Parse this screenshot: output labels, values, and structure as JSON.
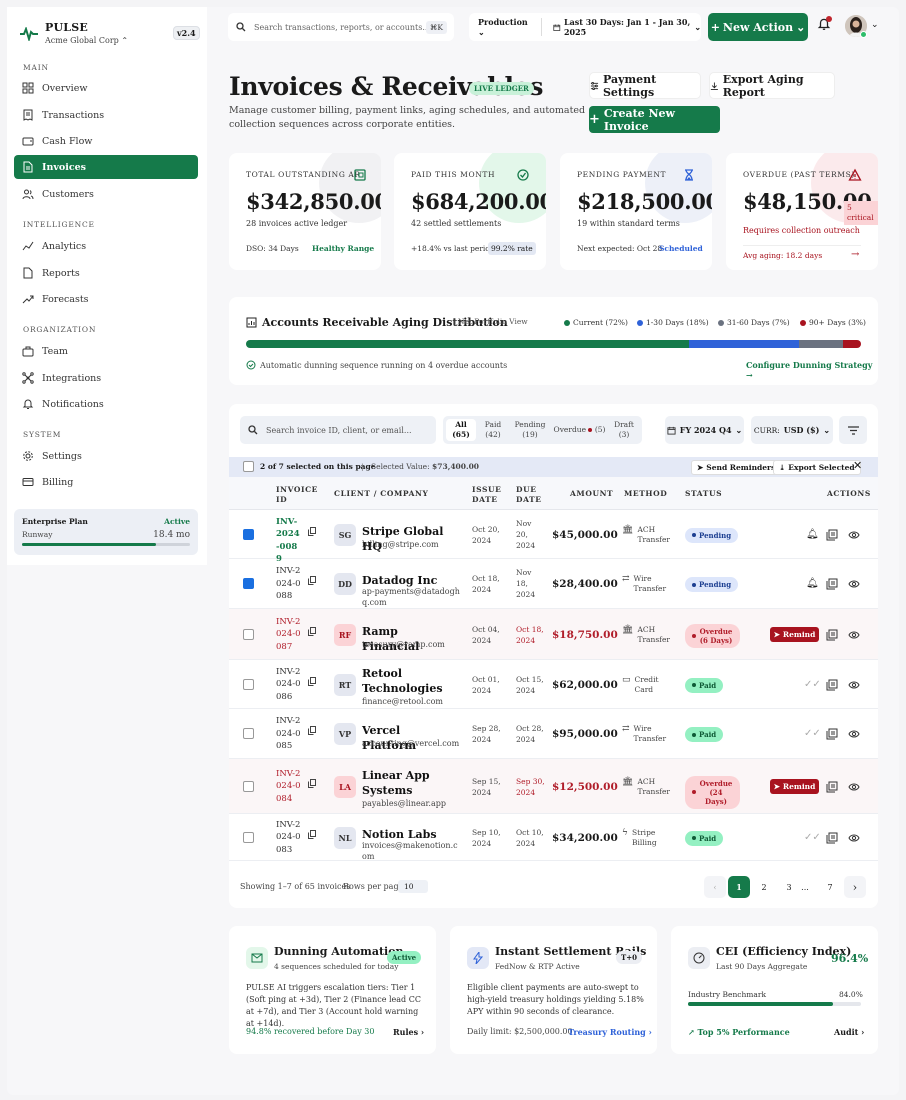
{
  "brand": {
    "name": "PULSE",
    "org": "Acme Global Corp",
    "version": "v2.4"
  },
  "nav": {
    "sections": {
      "main": "MAIN",
      "intelligence": "INTELLIGENCE",
      "organization": "ORGANIZATION",
      "system": "SYSTEM"
    },
    "items": [
      {
        "label": "Overview",
        "icon": "grid-icon"
      },
      {
        "label": "Transactions",
        "icon": "receipt-icon"
      },
      {
        "label": "Cash Flow",
        "icon": "wallet-icon"
      },
      {
        "label": "Invoices",
        "icon": "document-icon",
        "active": true
      },
      {
        "label": "Customers",
        "icon": "users-icon"
      },
      {
        "label": "Analytics",
        "icon": "trend-icon"
      },
      {
        "label": "Reports",
        "icon": "file-icon"
      },
      {
        "label": "Forecasts",
        "icon": "chart-up-icon"
      },
      {
        "label": "Team",
        "icon": "briefcase-icon"
      },
      {
        "label": "Integrations",
        "icon": "network-icon"
      },
      {
        "label": "Notifications",
        "icon": "bell-icon"
      },
      {
        "label": "Settings",
        "icon": "gear-icon"
      },
      {
        "label": "Billing",
        "icon": "credit-card-icon"
      }
    ]
  },
  "plan": {
    "title": "Enterprise Plan",
    "status": "Active",
    "runway_label": "Runway",
    "runway_value": "18.4 mo",
    "runway_progress": 0.8
  },
  "topbar": {
    "search_placeholder": "Search transactions, reports, or accounts...",
    "shortcut": "⌘K",
    "environment": "Production",
    "date_range": "Last 30 Days: Jan 1 - Jan 30, 2025",
    "new_action": "New Action"
  },
  "header": {
    "title": "Invoices & Receivables",
    "badge": "LIVE LEDGER",
    "subtitle": "Manage customer billing, payment links, aging schedules, and automated collection sequences across corporate entities.",
    "payment_settings": "Payment Settings",
    "export_aging": "Export Aging Report",
    "create_invoice": "Create New Invoice"
  },
  "kpis": [
    {
      "label": "TOTAL OUTSTANDING AR",
      "value": "$342,850.00",
      "sub": "28 invoices active ledger",
      "foot_left": "DSO: 34 Days",
      "foot_right": "Healthy Range"
    },
    {
      "label": "PAID THIS MONTH",
      "value": "$684,200.00",
      "sub": "42 settled settlements",
      "foot_left": "+18.4% vs last period",
      "foot_right": "99.2% rate"
    },
    {
      "label": "PENDING PAYMENT",
      "value": "$218,500.00",
      "sub": "19 within standard terms",
      "foot_left": "Next expected: Oct 28",
      "foot_right": "Scheduled"
    },
    {
      "label": "OVERDUE (PAST TERMS)",
      "value": "$48,150.00",
      "badge": "5 critical",
      "sub": "Requires collection outreach",
      "foot_left": "Avg aging: 18.2 days"
    }
  ],
  "aging": {
    "title": "Accounts Receivable Aging Distribution",
    "subtitle": "| Net Portfolio View",
    "buckets": [
      {
        "label": "Current (72%)",
        "pct": 72,
        "color": "#157a4a"
      },
      {
        "label": "1-30 Days (18%)",
        "pct": 18,
        "color": "#2f62d8"
      },
      {
        "label": "31-60 Days (7%)",
        "pct": 7,
        "color": "#6b7280"
      },
      {
        "label": "90+ Days (3%)",
        "pct": 3,
        "color": "#a8131f"
      }
    ],
    "note": "Automatic dunning sequence running on 4 overdue accounts",
    "link": "Configure Dunning Strategy"
  },
  "table": {
    "search_placeholder": "Search invoice ID, client, or email...",
    "filters": [
      {
        "label": "All",
        "count": "(65)"
      },
      {
        "label": "Paid",
        "count": "(42)"
      },
      {
        "label": "Pending",
        "count": "(19)"
      },
      {
        "label": "Overdue",
        "count": "(5)"
      },
      {
        "label": "Draft",
        "count": "(3)"
      }
    ],
    "period": "FY 2024 Q4",
    "currency_label": "CURR:",
    "currency": "USD ($)",
    "selection": {
      "text": "2 of 7 selected on this page",
      "sep": "|",
      "value_text": "Selected Value:",
      "value": "$73,400.00",
      "send": "Send Reminders",
      "export": "Export Selected"
    },
    "columns": [
      "INVOICE ID",
      "CLIENT / COMPANY",
      "ISSUE DATE",
      "DUE DATE",
      "AMOUNT",
      "METHOD",
      "STATUS",
      "ACTIONS"
    ],
    "rows": [
      {
        "id": "INV-2024-0089",
        "initials": "SG",
        "name": "Stripe Global HQ",
        "email": "billing@stripe.com",
        "issue": "Oct 20, 2024",
        "due": "Nov 20, 2024",
        "amount": "$45,000.00",
        "method": "ACH Transfer",
        "status": "Pending",
        "state": "pending",
        "checked": true
      },
      {
        "id": "INV-2024-0088",
        "initials": "DD",
        "name": "Datadog Inc",
        "email": "ap-payments@datadoghq.com",
        "issue": "Oct 18, 2024",
        "due": "Nov 18, 2024",
        "amount": "$28,400.00",
        "method": "Wire Transfer",
        "status": "Pending",
        "state": "pending",
        "checked": true
      },
      {
        "id": "INV-2024-0087",
        "initials": "RF",
        "name": "Ramp Financial",
        "email": "treasury@ramp.com",
        "issue": "Oct 04, 2024",
        "due": "Oct 18, 2024",
        "amount": "$18,750.00",
        "method": "ACH Transfer",
        "status": "Overdue (6 Days)",
        "state": "overdue",
        "checked": false
      },
      {
        "id": "INV-2024-0086",
        "initials": "RT",
        "name": "Retool Technologies",
        "email": "finance@retool.com",
        "issue": "Oct 01, 2024",
        "due": "Oct 15, 2024",
        "amount": "$62,000.00",
        "method": "Credit Card",
        "status": "Paid",
        "state": "paid",
        "checked": false
      },
      {
        "id": "INV-2024-0085",
        "initials": "VP",
        "name": "Vercel Platform",
        "email": "accounting@vercel.com",
        "issue": "Sep 28, 2024",
        "due": "Oct 28, 2024",
        "amount": "$95,000.00",
        "method": "Wire Transfer",
        "status": "Paid",
        "state": "paid",
        "checked": false
      },
      {
        "id": "INV-2024-0084",
        "initials": "LA",
        "name": "Linear App Systems",
        "email": "payables@linear.app",
        "issue": "Sep 15, 2024",
        "due": "Sep 30, 2024",
        "amount": "$12,500.00",
        "method": "ACH Transfer",
        "status": "Overdue (24 Days)",
        "state": "overdue",
        "checked": false
      },
      {
        "id": "INV-2024-0083",
        "initials": "NL",
        "name": "Notion Labs",
        "email": "invoices@makenotion.com",
        "issue": "Sep 10, 2024",
        "due": "Oct 10, 2024",
        "amount": "$34,200.00",
        "method": "Stripe Billing",
        "status": "Paid",
        "state": "paid",
        "checked": false
      }
    ],
    "remind_label": "Remind",
    "footer": {
      "showing": "Showing 1–7 of 65 invoices",
      "rows_label": "Rows per page:",
      "rows_value": "10"
    },
    "pages": [
      "1",
      "2",
      "3",
      "...",
      "7"
    ]
  },
  "cards": [
    {
      "title": "Dunning Automation",
      "badge": "Active",
      "sub": "4 sequences scheduled for today",
      "body": "PULSE AI triggers escalation tiers: Tier 1 (Soft ping at +3d), Tier 2 (Finance lead CC at +7d), and Tier 3 (Account hold warning at +14d).",
      "foot_left": "94.8% recovered before Day 30",
      "foot_right": "Rules"
    },
    {
      "title": "Instant Settlement Rails",
      "badge": "T+0",
      "sub": "FedNow & RTP Active",
      "body": "Eligible client payments are auto-swept to high-yield treasury holdings yielding 5.18% APY within 90 seconds of clearance.",
      "foot_left": "Daily limit: $2,500,000.00",
      "foot_right": "Treasury Routing"
    },
    {
      "title": "CEI (Efficiency Index)",
      "value": "96.4%",
      "sub": "Last 90 Days Aggregate",
      "bench_label": "Industry Benchmark",
      "bench_value": "84.0%",
      "bench_progress": 0.84,
      "foot_left": "Top 5% Performance",
      "foot_right": "Audit"
    }
  ]
}
